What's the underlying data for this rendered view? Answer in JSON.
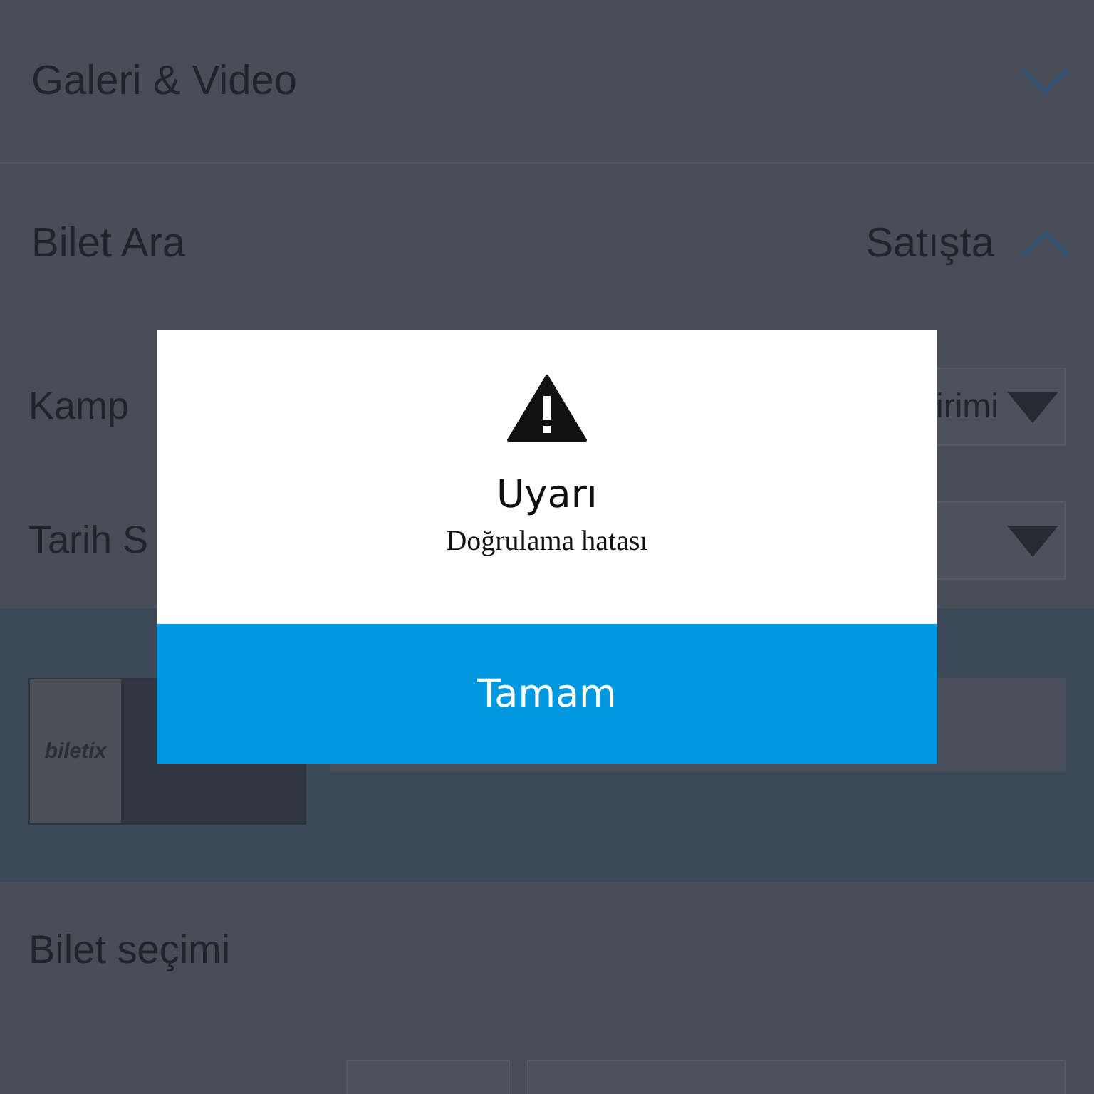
{
  "sections": [
    {
      "title": "Galeri & Video",
      "expanded": false
    },
    {
      "title": "Bilet Ara",
      "status": "Satışta",
      "expanded": true
    }
  ],
  "filters": [
    {
      "label": "Kamp",
      "value": "irimi"
    },
    {
      "label": "Tarih S"
    }
  ],
  "event": {
    "logo": "biletix"
  },
  "ticket_section": {
    "title": "Bilet seçimi"
  },
  "dialog": {
    "title": "Uyarı",
    "message": "Doğrulama hatası",
    "button": "Tamam"
  }
}
